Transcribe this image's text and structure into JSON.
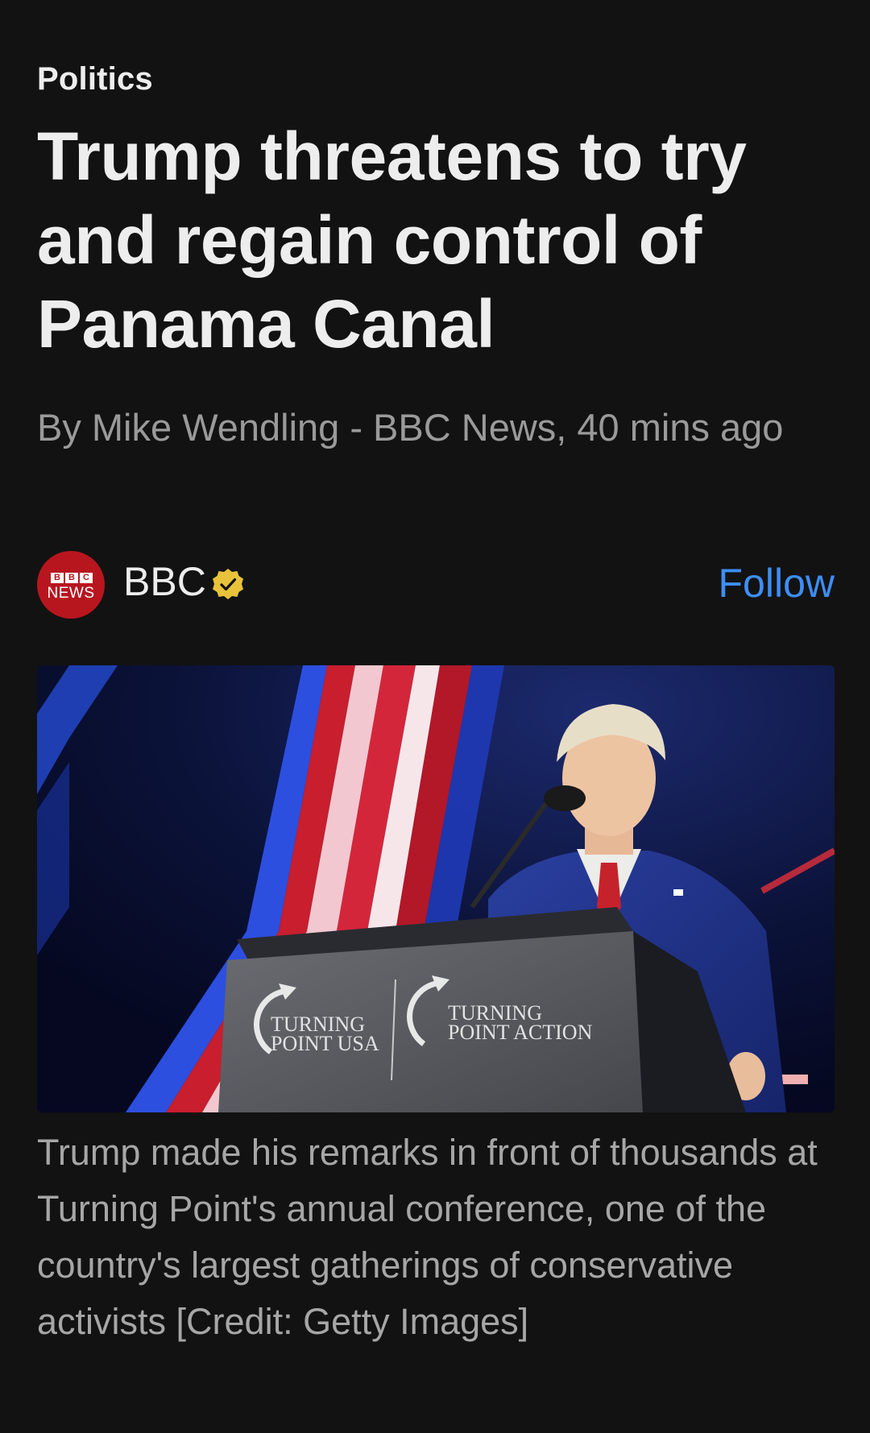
{
  "article": {
    "category": "Politics",
    "headline": "Trump threatens to try and regain control of Panama Canal",
    "byline": "By Mike Wendling - BBC News, 40 mins ago",
    "publisher": {
      "name": "BBC",
      "logo_text_top": "BBC",
      "logo_text_bottom": "NEWS",
      "verified": true,
      "follow_label": "Follow"
    },
    "image": {
      "description": "Speaker at a lectern on stage",
      "podium_left_text": [
        "TURNING",
        "POINT USA"
      ],
      "podium_right_text": [
        "TURNING",
        "POINT ACTION"
      ]
    },
    "caption": "Trump made his remarks in front of thousands at Turning Point's annual conference, one of the country's largest gatherings of conservative activists [Credit: Getty Images]"
  },
  "colors": {
    "background": "#121212",
    "text_primary": "#ededed",
    "text_secondary": "#9a9a9a",
    "accent_follow": "#3d8ef5",
    "bbc_red": "#b8161f",
    "verified_gold": "#e8c23a"
  },
  "icons": {
    "verified": "verified-badge-icon",
    "publisher_logo": "bbc-news-logo"
  }
}
